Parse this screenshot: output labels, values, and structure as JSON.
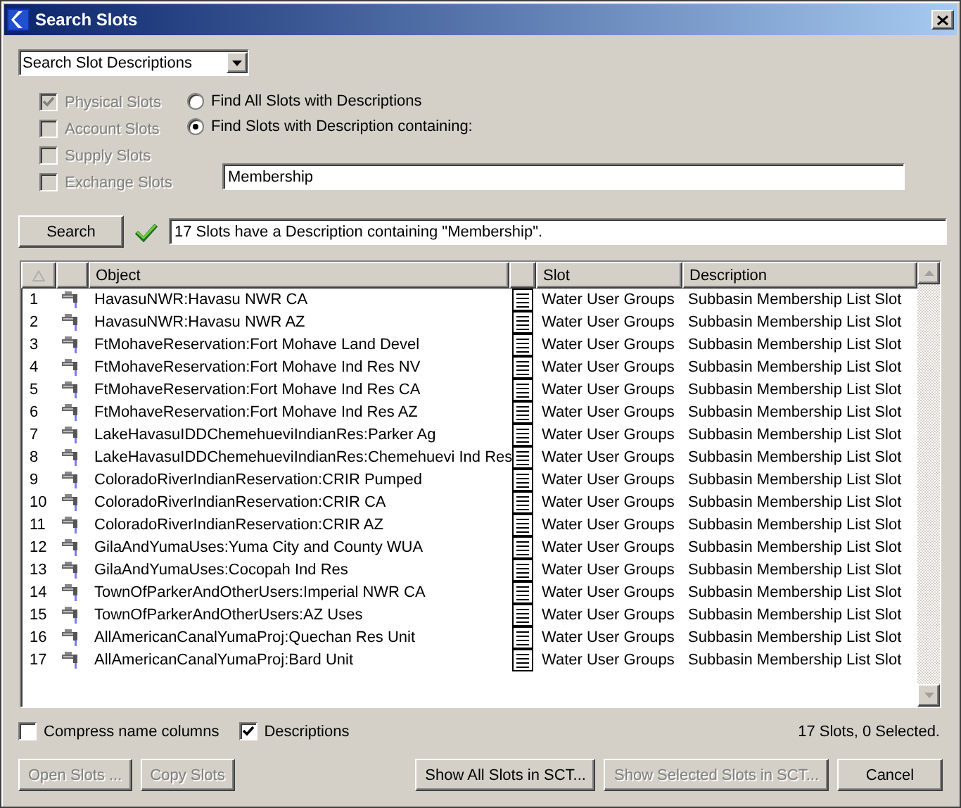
{
  "window": {
    "title": "Search Slots"
  },
  "search_mode": {
    "value": "Search Slot Descriptions"
  },
  "slot_types": [
    {
      "label": "Physical Slots",
      "checked": true,
      "disabled": true
    },
    {
      "label": "Account Slots",
      "checked": false,
      "disabled": true
    },
    {
      "label": "Supply Slots",
      "checked": false,
      "disabled": true
    },
    {
      "label": "Exchange Slots",
      "checked": false,
      "disabled": true
    }
  ],
  "find_options": [
    {
      "label": "Find All Slots with Descriptions",
      "selected": false
    },
    {
      "label": "Find Slots with Description containing:",
      "selected": true
    }
  ],
  "search_text": {
    "value": "Membership"
  },
  "search_button": {
    "label": "Search"
  },
  "result_message": "17 Slots have a Description containing \"Membership\".",
  "table": {
    "columns": [
      "Object",
      "Slot",
      "Description"
    ],
    "rows": [
      {
        "number": "1",
        "object": "HavasuNWR:Havasu NWR CA",
        "slot": "Water User Groups",
        "description": "Subbasin Membership List Slot"
      },
      {
        "number": "2",
        "object": "HavasuNWR:Havasu NWR AZ",
        "slot": "Water User Groups",
        "description": "Subbasin Membership List Slot"
      },
      {
        "number": "3",
        "object": "FtMohaveReservation:Fort Mohave Land Devel",
        "slot": "Water User Groups",
        "description": "Subbasin Membership List Slot"
      },
      {
        "number": "4",
        "object": "FtMohaveReservation:Fort Mohave Ind Res NV",
        "slot": "Water User Groups",
        "description": "Subbasin Membership List Slot"
      },
      {
        "number": "5",
        "object": "FtMohaveReservation:Fort Mohave Ind Res CA",
        "slot": "Water User Groups",
        "description": "Subbasin Membership List Slot"
      },
      {
        "number": "6",
        "object": "FtMohaveReservation:Fort Mohave Ind Res AZ",
        "slot": "Water User Groups",
        "description": "Subbasin Membership List Slot"
      },
      {
        "number": "7",
        "object": "LakeHavasuIDDChemehueviIndianRes:Parker Ag",
        "slot": "Water User Groups",
        "description": "Subbasin Membership List Slot"
      },
      {
        "number": "8",
        "object": "LakeHavasuIDDChemehueviIndianRes:Chemehuevi Ind Res",
        "slot": "Water User Groups",
        "description": "Subbasin Membership List Slot"
      },
      {
        "number": "9",
        "object": "ColoradoRiverIndianReservation:CRIR Pumped",
        "slot": "Water User Groups",
        "description": "Subbasin Membership List Slot"
      },
      {
        "number": "10",
        "object": "ColoradoRiverIndianReservation:CRIR CA",
        "slot": "Water User Groups",
        "description": "Subbasin Membership List Slot"
      },
      {
        "number": "11",
        "object": "ColoradoRiverIndianReservation:CRIR AZ",
        "slot": "Water User Groups",
        "description": "Subbasin Membership List Slot"
      },
      {
        "number": "12",
        "object": "GilaAndYumaUses:Yuma City and County WUA",
        "slot": "Water User Groups",
        "description": "Subbasin Membership List Slot"
      },
      {
        "number": "13",
        "object": "GilaAndYumaUses:Cocopah Ind Res",
        "slot": "Water User Groups",
        "description": "Subbasin Membership List Slot"
      },
      {
        "number": "14",
        "object": "TownOfParkerAndOtherUsers:Imperial NWR CA",
        "slot": "Water User Groups",
        "description": "Subbasin Membership List Slot"
      },
      {
        "number": "15",
        "object": "TownOfParkerAndOtherUsers:AZ Uses",
        "slot": "Water User Groups",
        "description": "Subbasin Membership List Slot"
      },
      {
        "number": "16",
        "object": "AllAmericanCanalYumaProj:Quechan Res Unit",
        "slot": "Water User Groups",
        "description": "Subbasin Membership List Slot"
      },
      {
        "number": "17",
        "object": "AllAmericanCanalYumaProj:Bard Unit",
        "slot": "Water User Groups",
        "description": "Subbasin Membership List Slot"
      }
    ]
  },
  "options": [
    {
      "label": "Compress name columns",
      "checked": false
    },
    {
      "label": "Descriptions",
      "checked": true
    }
  ],
  "summary": "17 Slots, 0 Selected.",
  "buttons": [
    {
      "label": "Open Slots ...",
      "disabled": true
    },
    {
      "label": "Copy Slots",
      "disabled": true
    },
    {
      "label": "Show All Slots in SCT...",
      "disabled": false
    },
    {
      "label": "Show Selected Slots in SCT...",
      "disabled": true
    },
    {
      "label": "Cancel",
      "disabled": false
    }
  ]
}
